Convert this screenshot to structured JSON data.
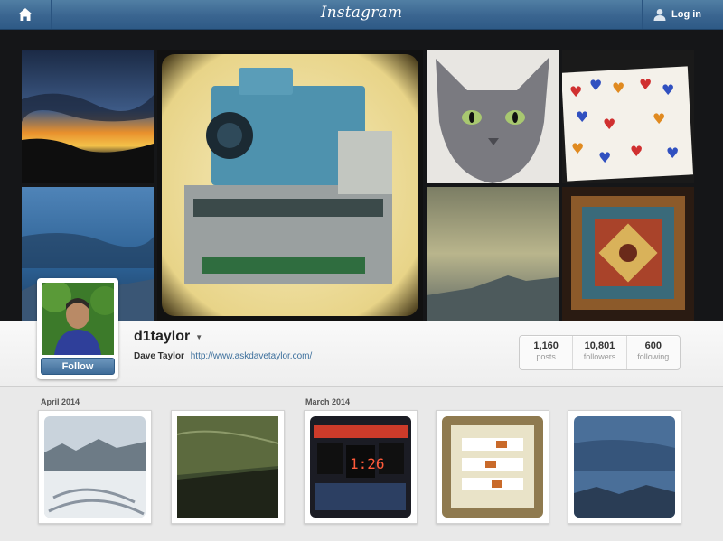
{
  "topbar": {
    "home_icon": "home-icon",
    "logo": "Instagram",
    "login_label": "Log in",
    "user_icon": "user-icon"
  },
  "cover": {
    "tiles": [
      "sunset-photo",
      "camera-photo",
      "cat-photo",
      "hearts-drawing-photo",
      "blue-sky-photo",
      "hazy-mountain-photo",
      "ornate-ceiling-photo"
    ]
  },
  "profile": {
    "username": "d1taylor",
    "full_name": "Dave Taylor",
    "website": "http://www.askdavetaylor.com/",
    "follow_label": "Follow",
    "stats": [
      {
        "value": "1,160",
        "label": "posts"
      },
      {
        "value": "10,801",
        "label": "followers"
      },
      {
        "value": "600",
        "label": "following"
      }
    ]
  },
  "feed": {
    "months": [
      "April 2014",
      "March 2014"
    ]
  },
  "colors": {
    "header_blue": "#3a6590",
    "link_blue": "#3c6f9c",
    "follow_blue": "#4f7ca8"
  }
}
